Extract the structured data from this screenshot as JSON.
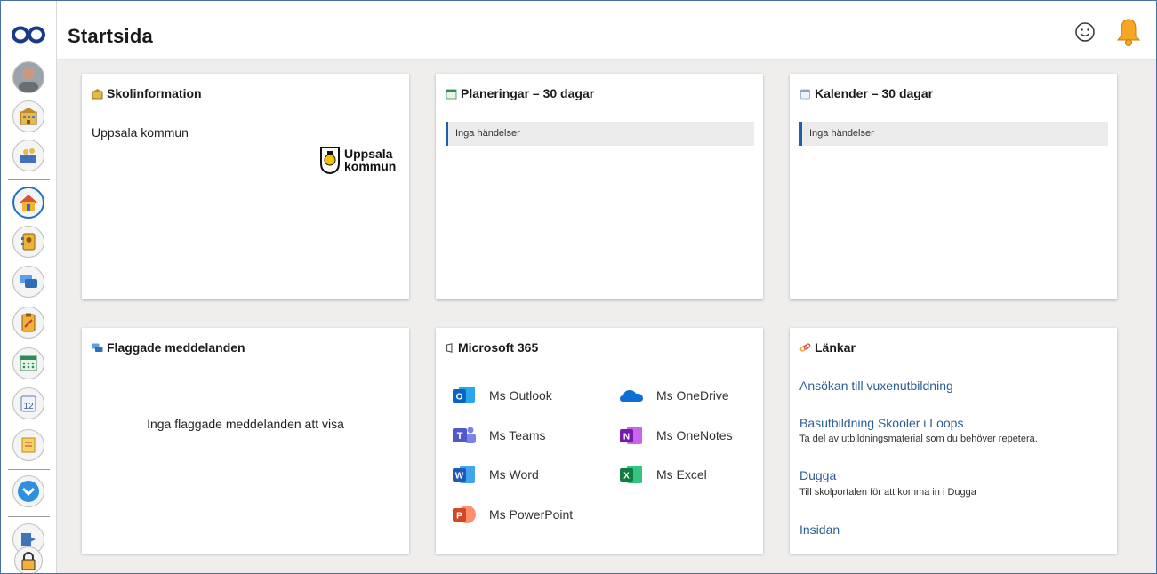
{
  "header": {
    "title": "Startsida"
  },
  "cards": {
    "skolinfo": {
      "title": "Skolinformation",
      "text": "Uppsala kommun",
      "logo_line1": "Uppsala",
      "logo_line2": "kommun"
    },
    "planeringar": {
      "title": "Planeringar – 30 dagar",
      "event": "Inga händelser"
    },
    "kalender": {
      "title": "Kalender – 30 dagar",
      "event": "Inga händelser"
    },
    "flaggade": {
      "title": "Flaggade meddelanden",
      "empty_text": "Inga flaggade meddelanden att visa"
    },
    "microsoft": {
      "title": "Microsoft 365",
      "apps": [
        {
          "label": "Ms Outlook",
          "icon": "outlook-icon",
          "color": "#0a64c8"
        },
        {
          "label": "Ms OneDrive",
          "icon": "onedrive-icon",
          "color": "#0d6fd1"
        },
        {
          "label": "Ms Teams",
          "icon": "teams-icon",
          "color": "#5059c9"
        },
        {
          "label": "Ms OneNotes",
          "icon": "onenote-icon",
          "color": "#7719aa"
        },
        {
          "label": "Ms Word",
          "icon": "word-icon",
          "color": "#1e5ab7"
        },
        {
          "label": "Ms Excel",
          "icon": "excel-icon",
          "color": "#107c41"
        },
        {
          "label": "Ms PowerPoint",
          "icon": "powerpoint-icon",
          "color": "#d24726"
        }
      ]
    },
    "lankar": {
      "title": "Länkar",
      "links": [
        {
          "label": "Ansökan till vuxenutbildning",
          "desc": ""
        },
        {
          "label": "Basutbildning Skooler i Loops",
          "desc": "Ta del av utbildningsmaterial som du behöver repetera."
        },
        {
          "label": "Dugga",
          "desc": "Till skolportalen för att komma in i Dugga"
        },
        {
          "label": "Insidan",
          "desc": ""
        }
      ]
    }
  },
  "colors": {
    "accent": "#1f6fc4",
    "link": "#2a5d9a",
    "event_bar": "#1f5fa8",
    "background": "#efeeec"
  }
}
